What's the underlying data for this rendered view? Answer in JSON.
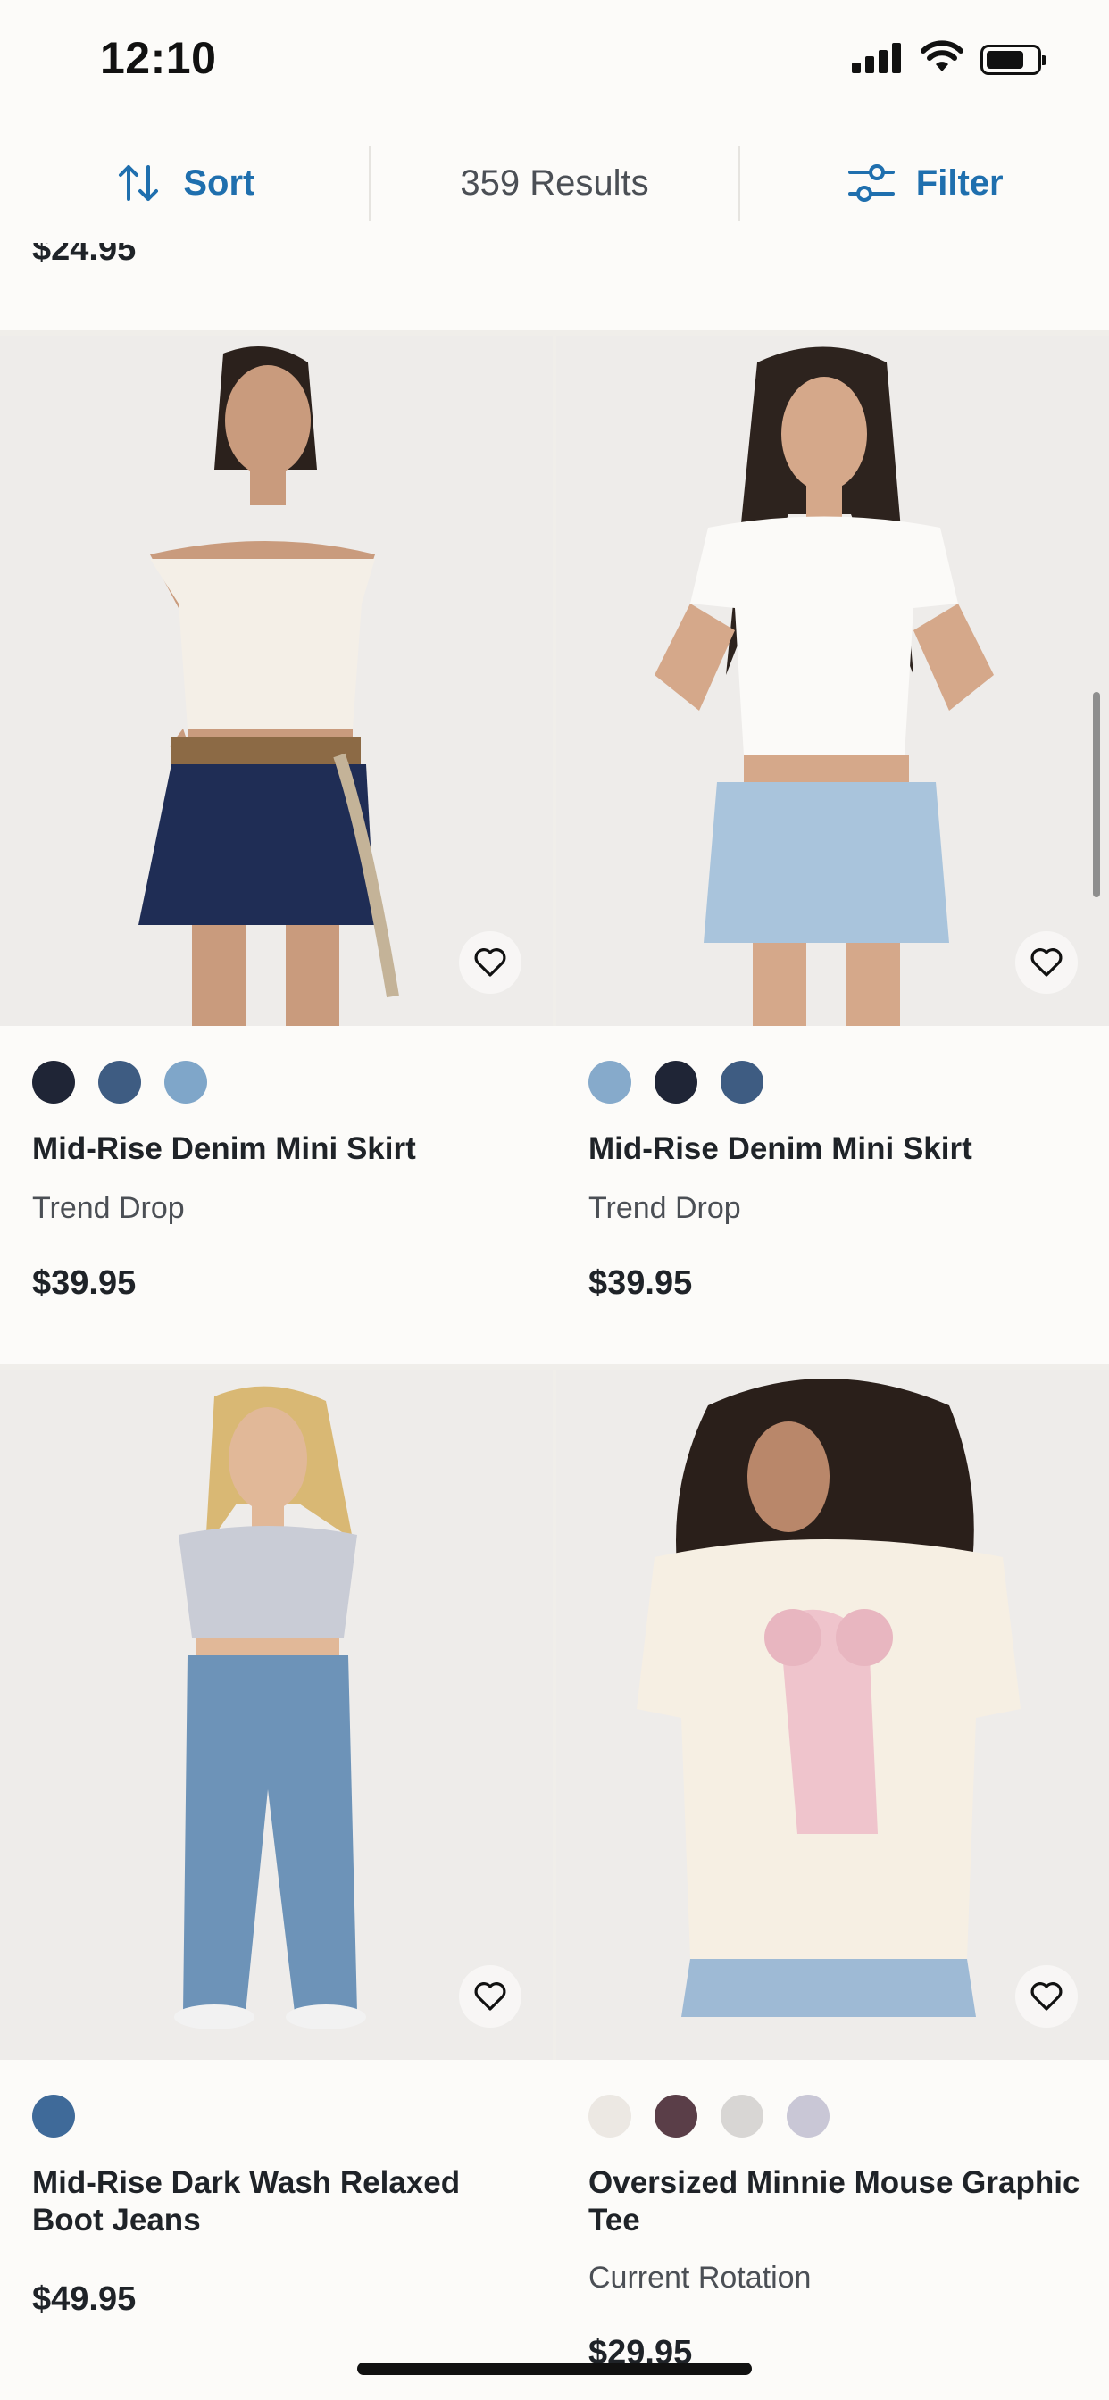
{
  "status_bar": {
    "time": "12:10",
    "battery_level": 0.75
  },
  "toolbar": {
    "sort_label": "Sort",
    "results_text": "359 Results",
    "filter_label": "Filter"
  },
  "previous_row": {
    "price": "$24.95"
  },
  "products": [
    {
      "title": "Mid-Rise Denim Mini Skirt",
      "collection": "Trend Drop",
      "price": "$39.95",
      "swatches": [
        "#1f2536",
        "#3e5c82",
        "#7fa6c9"
      ]
    },
    {
      "title": "Mid-Rise Denim Mini Skirt",
      "collection": "Trend Drop",
      "price": "$39.95",
      "swatches": [
        "#86aacb",
        "#1f2536",
        "#3e5c82"
      ]
    },
    {
      "title": "Mid-Rise Dark Wash Relaxed Boot Jeans",
      "collection": "",
      "price": "$49.95",
      "swatches": [
        "#3f6a99"
      ]
    },
    {
      "title": "Oversized Minnie Mouse Graphic Tee",
      "collection": "Current Rotation",
      "price": "$29.95",
      "swatches": [
        "#ece8e3",
        "#5a3e48",
        "#d8d6d4",
        "#c9c7d6"
      ]
    }
  ],
  "colors": {
    "accent": "#1f6fae",
    "text": "#1f2328",
    "muted": "#4b4f55",
    "background": "#fcfbf9"
  }
}
